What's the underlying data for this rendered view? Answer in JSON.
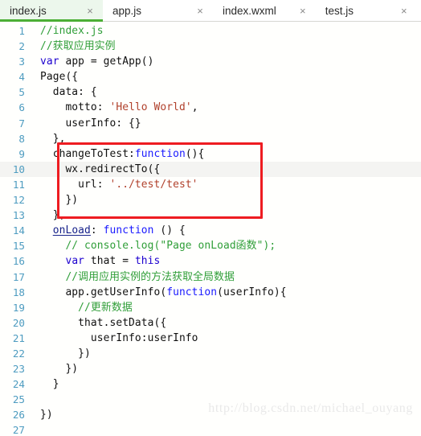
{
  "window": {
    "title": "index.js",
    "accent_green": "#4caf35",
    "active_tab_bg": "#ecf7ec",
    "annotation_color": "#ee1c21",
    "gutter_color": "#4e9cc0"
  },
  "tabs": [
    {
      "label": "index.js",
      "close": "×",
      "active": true
    },
    {
      "label": "app.js",
      "close": "×",
      "active": false
    },
    {
      "label": "index.wxml",
      "close": "×",
      "active": false
    },
    {
      "label": "test.js",
      "close": "×",
      "active": false
    }
  ],
  "editor": {
    "current_line": 10,
    "annotation": {
      "type": "red-rectangle",
      "covers_lines": [
        9,
        10,
        11,
        12,
        13
      ]
    },
    "lines": [
      {
        "n": "1",
        "tokens": [
          {
            "t": "//index.js",
            "c": "t-comment"
          }
        ]
      },
      {
        "n": "2",
        "tokens": [
          {
            "t": "//获取应用实例",
            "c": "t-comment"
          }
        ]
      },
      {
        "n": "3",
        "tokens": [
          {
            "t": "var",
            "c": "t-keyword"
          },
          {
            "t": " app = getApp()",
            "c": "t-plain"
          }
        ]
      },
      {
        "n": "4",
        "tokens": [
          {
            "t": "Page({",
            "c": "t-plain"
          }
        ]
      },
      {
        "n": "5",
        "tokens": [
          {
            "t": "  data: {",
            "c": "t-plain"
          }
        ]
      },
      {
        "n": "6",
        "tokens": [
          {
            "t": "    motto: ",
            "c": "t-plain"
          },
          {
            "t": "'Hello World'",
            "c": "t-string"
          },
          {
            "t": ",",
            "c": "t-plain"
          }
        ]
      },
      {
        "n": "7",
        "tokens": [
          {
            "t": "    userInfo: {}",
            "c": "t-plain"
          }
        ]
      },
      {
        "n": "8",
        "tokens": [
          {
            "t": "  },",
            "c": "t-plain"
          }
        ]
      },
      {
        "n": "9",
        "tokens": [
          {
            "t": "  changeToTest:",
            "c": "t-plain"
          },
          {
            "t": "function",
            "c": "t-func"
          },
          {
            "t": "(){",
            "c": "t-plain"
          }
        ]
      },
      {
        "n": "10",
        "tokens": [
          {
            "t": "    wx.redirectTo({",
            "c": "t-plain"
          }
        ]
      },
      {
        "n": "11",
        "tokens": [
          {
            "t": "      url: ",
            "c": "t-plain"
          },
          {
            "t": "'../test/test'",
            "c": "t-string"
          }
        ]
      },
      {
        "n": "12",
        "tokens": [
          {
            "t": "    })",
            "c": "t-plain"
          }
        ]
      },
      {
        "n": "13",
        "tokens": [
          {
            "t": "  },",
            "c": "t-plain"
          }
        ]
      },
      {
        "n": "14",
        "tokens": [
          {
            "t": "  ",
            "c": "t-plain"
          },
          {
            "t": "onLoad",
            "c": "t-prop-underline"
          },
          {
            "t": ": ",
            "c": "t-plain"
          },
          {
            "t": "function",
            "c": "t-func"
          },
          {
            "t": " () {",
            "c": "t-plain"
          }
        ]
      },
      {
        "n": "15",
        "tokens": [
          {
            "t": "    // console.log(\"Page onLoad函数\");",
            "c": "t-comment"
          }
        ]
      },
      {
        "n": "16",
        "tokens": [
          {
            "t": "    ",
            "c": "t-plain"
          },
          {
            "t": "var",
            "c": "t-keyword"
          },
          {
            "t": " that = ",
            "c": "t-plain"
          },
          {
            "t": "this",
            "c": "t-keyword"
          }
        ]
      },
      {
        "n": "17",
        "tokens": [
          {
            "t": "    //调用应用实例的方法获取全局数据",
            "c": "t-comment"
          }
        ]
      },
      {
        "n": "18",
        "tokens": [
          {
            "t": "    app.getUserInfo(",
            "c": "t-plain"
          },
          {
            "t": "function",
            "c": "t-func"
          },
          {
            "t": "(userInfo){",
            "c": "t-plain"
          }
        ]
      },
      {
        "n": "19",
        "tokens": [
          {
            "t": "      //更新数据",
            "c": "t-comment"
          }
        ]
      },
      {
        "n": "20",
        "tokens": [
          {
            "t": "      that.setData({",
            "c": "t-plain"
          }
        ]
      },
      {
        "n": "21",
        "tokens": [
          {
            "t": "        userInfo:userInfo",
            "c": "t-plain"
          }
        ]
      },
      {
        "n": "22",
        "tokens": [
          {
            "t": "      })",
            "c": "t-plain"
          }
        ]
      },
      {
        "n": "23",
        "tokens": [
          {
            "t": "    })",
            "c": "t-plain"
          }
        ]
      },
      {
        "n": "24",
        "tokens": [
          {
            "t": "  }",
            "c": "t-plain"
          }
        ]
      },
      {
        "n": "25",
        "tokens": [
          {
            "t": "",
            "c": "t-plain"
          }
        ]
      },
      {
        "n": "26",
        "tokens": [
          {
            "t": "})",
            "c": "t-plain"
          }
        ]
      },
      {
        "n": "27",
        "tokens": [
          {
            "t": "",
            "c": "t-plain"
          }
        ]
      }
    ]
  },
  "watermark": {
    "text": "http://blog.csdn.net/michael_ouyang"
  }
}
